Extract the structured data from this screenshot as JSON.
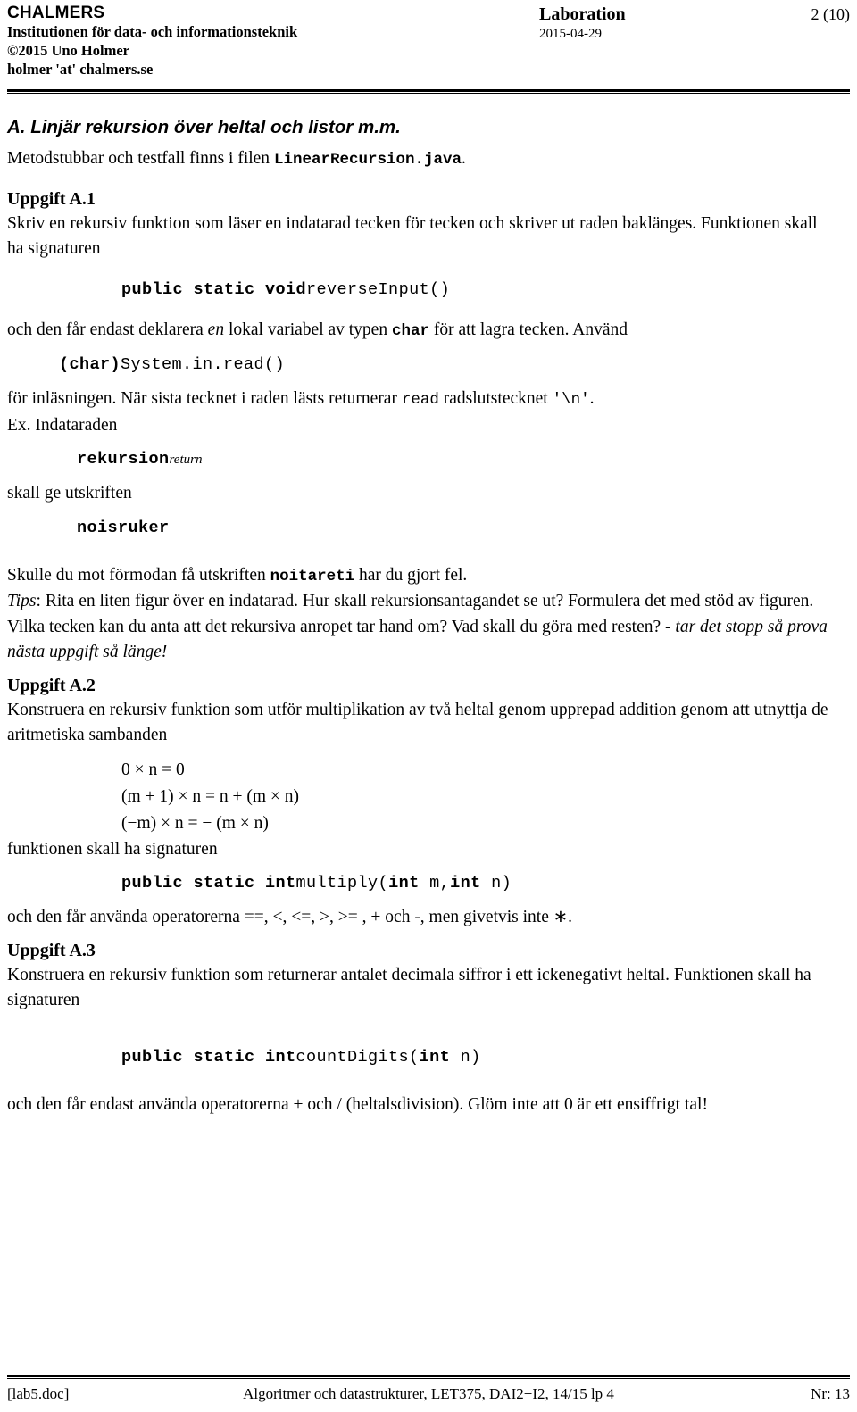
{
  "header": {
    "org": "CHALMERS",
    "department": "Institutionen för data- och informationsteknik",
    "copyright": "©2015 Uno Holmer",
    "email": "holmer 'at' chalmers.se",
    "doc_type": "Laboration",
    "date": "2015-04-29",
    "page_number": "2 (10)"
  },
  "section": {
    "title": "A. Linjär rekursion över heltal och listor m.m.",
    "intro_prefix": "Metodstubbar och testfall finns i filen ",
    "intro_file": "LinearRecursion.java",
    "intro_suffix": "."
  },
  "task1": {
    "heading": "Uppgift A.1",
    "para1": "Skriv en rekursiv funktion som läser en indatarad tecken för tecken och skriver ut raden baklänges. Funktionen skall ha signaturen",
    "signature_keywords": "public static void",
    "signature_name": "reverseInput()",
    "para2_a": "och den får endast deklarera ",
    "para2_em": "en",
    "para2_b": " lokal variabel av typen ",
    "para2_code": "char",
    "para2_c": " för att lagra tecken. Använd",
    "read_cast": "(char)",
    "read_call": "System.in.read()",
    "para3_a": "för inläsningen. När sista tecknet i raden lästs returnerar ",
    "para3_code": "read",
    "para3_b": " radslutstecknet ",
    "para3_newline": "'\\n'",
    "para3_c": ".",
    "para4": "Ex. Indataraden",
    "example_input": "rekursion",
    "example_input_note": "return",
    "para5": "skall ge utskriften",
    "example_output": "noisruker",
    "para6_a": "Skulle du mot förmodan få utskriften ",
    "para6_code": "noitareti",
    "para6_b": " har du gjort fel.",
    "tips_label": "Tips",
    "tips_body": ": Rita en liten figur över en indatarad. Hur skall rekursionsantagandet se ut? Formulera det med stöd av figuren. Vilka tecken kan du anta att det rekursiva anropet tar hand om? Vad skall du göra med resten? ",
    "tips_italic_tail": "- tar det stopp så prova nästa uppgift så länge!"
  },
  "task2": {
    "heading": "Uppgift A.2",
    "para1": "Konstruera en rekursiv funktion som utför multiplikation av två heltal genom upprepad addition genom att utnyttja de aritmetiska sambanden",
    "formulas": [
      "0 × n = 0",
      "(m + 1) × n  = n + (m × n)",
      "(−m) × n  =  − (m × n)"
    ],
    "para2": "funktionen skall ha signaturen",
    "signature_keywords": "public static int",
    "signature_name": "multiply(",
    "signature_arg1_kw": "int",
    "signature_arg1_name": " m,",
    "signature_arg2_kw": "int",
    "signature_arg2_name": " n)",
    "para3": "och den får använda operatorerna ==, <, <=, >, >= , + och -, men givetvis inte ∗."
  },
  "task3": {
    "heading": "Uppgift A.3",
    "para1": "Konstruera en rekursiv funktion som returnerar antalet decimala siffror i ett ickenegativt heltal. Funktionen skall ha signaturen",
    "signature_keywords": "public static int",
    "signature_name": "countDigits(",
    "signature_arg_kw": "int",
    "signature_arg_name": " n)",
    "para2": "och den får endast använda operatorerna + och / (heltalsdivision). Glöm inte att 0 är ett ensiffrigt tal!"
  },
  "footer": {
    "file": "[lab5.doc]",
    "course": "Algoritmer och datastrukturer, LET375, DAI2+I2, 14/15 lp 4",
    "number": "Nr: 13"
  }
}
